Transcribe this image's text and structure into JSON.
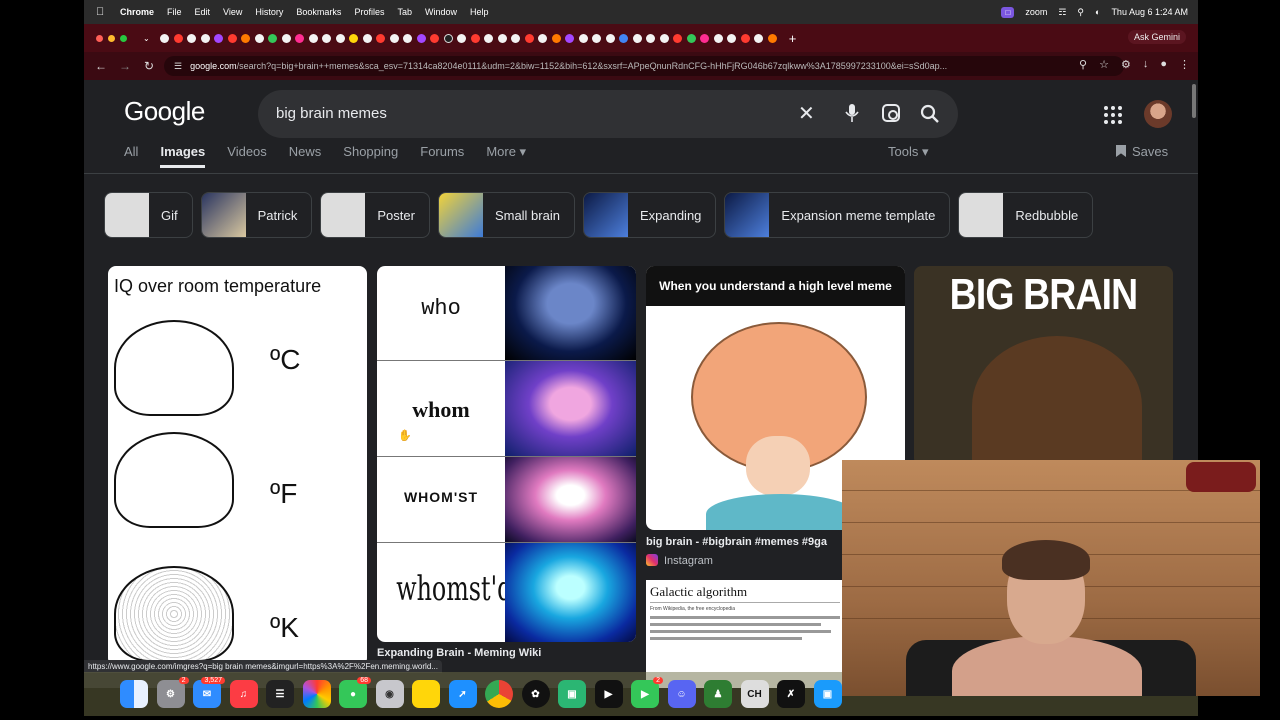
{
  "menubar": {
    "app": "Chrome",
    "menus": [
      "File",
      "Edit",
      "View",
      "History",
      "Bookmarks",
      "Profiles",
      "Tab",
      "Window",
      "Help"
    ],
    "zoom_label": "zoom",
    "datetime": "Thu Aug 6  1:24 AM"
  },
  "browser": {
    "ask_gemini": "Ask Gemini",
    "url_domain": "google.com",
    "url_path": "/search?q=big+brain++memes&sca_esv=71314ca8204e0111&udm=2&biw=1152&bih=612&sxsrf=APpeQnunRdnCFG-hHhFjRG046b67zqlkww%3A1785997233100&ei=sSd0ap..."
  },
  "google": {
    "logo": "Google",
    "query": "big brain memes",
    "filters": [
      "All",
      "Images",
      "Videos",
      "News",
      "Shopping",
      "Forums",
      "More"
    ],
    "active_filter": "Images",
    "tools": "Tools",
    "saves": "Saves",
    "chips": [
      "Gif",
      "Patrick",
      "Poster",
      "Small brain",
      "Expanding",
      "Expansion meme template",
      "Redbubble"
    ]
  },
  "results": {
    "card1": {
      "title": "IQ over room temperature",
      "units": [
        "ºC",
        "ºF",
        "ºK"
      ]
    },
    "card2": {
      "words": [
        "who",
        "whom",
        "WHOM'ST",
        "whomst'd"
      ],
      "caption": "Expanding Brain - Meming Wiki"
    },
    "card3": {
      "header": "When you understand a high level meme",
      "caption": "big brain - #bigbrain #memes #9ga",
      "source": "Instagram"
    },
    "card4": {
      "title": "BIG BRAIN"
    },
    "galactic": {
      "title": "Galactic algorithm",
      "subtitle": "From Wikipedia, the free encyclopedia"
    }
  },
  "status_url": "https://www.google.com/imgres?q=big brain  memes&imgurl=https%3A%2F%2Fen.meming.world...",
  "dock": {
    "mail_badge": "3,527",
    "badge_settings": "2",
    "badge_messages": "68",
    "badge_facetime": "2"
  }
}
